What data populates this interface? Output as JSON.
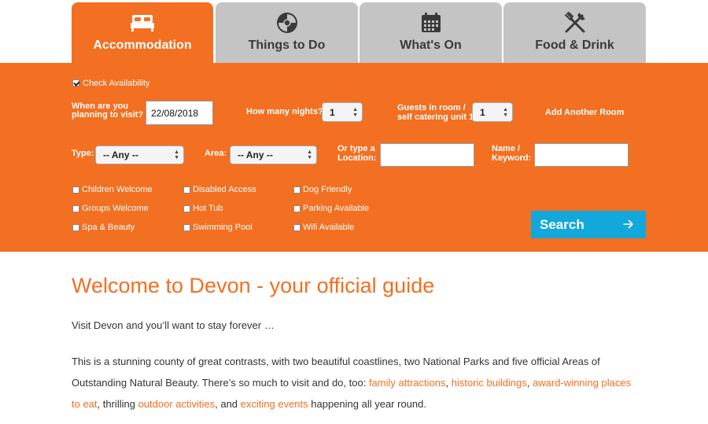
{
  "tabs": [
    {
      "label": "Accommodation",
      "icon": "bed-icon",
      "active": true
    },
    {
      "label": "Things to Do",
      "icon": "ball-icon",
      "active": false
    },
    {
      "label": "What's On",
      "icon": "calendar-icon",
      "active": false
    },
    {
      "label": "Food & Drink",
      "icon": "cutlery-icon",
      "active": false
    }
  ],
  "search": {
    "check_availability": "Check Availability",
    "visit_label_line1": "When are you",
    "visit_label_line2": "planning to visit?",
    "visit_date": "22/08/2018",
    "nights_label": "How many nights?",
    "nights_value": "1",
    "guests_label_line1": "Guests in room /",
    "guests_label_line2": "self catering unit 1",
    "guests_value": "1",
    "add_room": "Add Another Room",
    "type_label": "Type:",
    "type_value": "-- Any --",
    "area_label": "Area:",
    "area_value": "-- Any --",
    "location_label_line1": "Or type a",
    "location_label_line2": "Location:",
    "location_value": "",
    "name_label_line1": "Name /",
    "name_label_line2": "Keyword:",
    "name_value": "",
    "features": [
      "Children Welcome",
      "Disabled Access",
      "Dog Friendly",
      "Groups Welcome",
      "Hot Tub",
      "Parking Available",
      "Spa & Beauty",
      "Swimming Pool",
      "Wifi Available"
    ],
    "button_label": "Search"
  },
  "content": {
    "heading": "Welcome to Devon - your official guide",
    "intro": "Visit Devon and you’ll want to stay forever …",
    "para_1": "This is a stunning county of great contrasts, with two beautiful coastlines, two National Parks and five official Areas of Outstanding Natural Beauty. There’s so much to visit and do, too: ",
    "link_1": "family attractions",
    "sep_1": ", ",
    "link_2": "historic buildings",
    "sep_2": ", ",
    "link_3": "award-winning places to eat",
    "sep_3": ", thrilling ",
    "link_4": "outdoor activities",
    "sep_4": ", and ",
    "link_5": "exciting events",
    "para_end": " happening all year round."
  },
  "colors": {
    "brand_orange": "#f36f21",
    "search_blue": "#12a8dc",
    "tab_grey": "#c4c4c4"
  }
}
